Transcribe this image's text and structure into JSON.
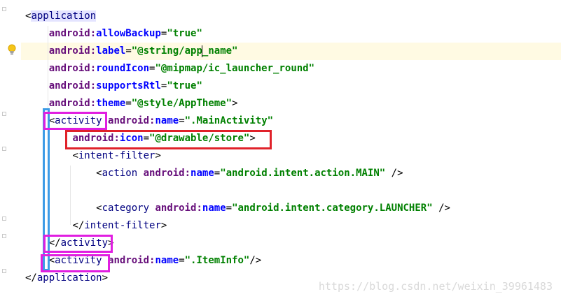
{
  "editor": {
    "lines": [
      [
        {
          "t": "br",
          "v": "<"
        },
        {
          "t": "tag",
          "v": "application",
          "hl": true
        }
      ],
      [
        {
          "t": "plain",
          "v": "    "
        },
        {
          "t": "ns",
          "v": "android:"
        },
        {
          "t": "attr",
          "v": "allowBackup"
        },
        {
          "t": "plain",
          "v": "="
        },
        {
          "t": "val",
          "v": "\"true\""
        }
      ],
      [
        {
          "t": "plain",
          "v": "    "
        },
        {
          "t": "ns",
          "v": "android:"
        },
        {
          "t": "attr",
          "v": "label"
        },
        {
          "t": "plain",
          "v": "="
        },
        {
          "t": "val",
          "v": "\"@string/app"
        },
        {
          "t": "caret"
        },
        {
          "t": "val",
          "v": "_name\""
        }
      ],
      [
        {
          "t": "plain",
          "v": "    "
        },
        {
          "t": "ns",
          "v": "android:"
        },
        {
          "t": "attr",
          "v": "roundIcon"
        },
        {
          "t": "plain",
          "v": "="
        },
        {
          "t": "val",
          "v": "\"@mipmap/ic_launcher_round\""
        }
      ],
      [
        {
          "t": "plain",
          "v": "    "
        },
        {
          "t": "ns",
          "v": "android:"
        },
        {
          "t": "attr",
          "v": "supportsRtl"
        },
        {
          "t": "plain",
          "v": "="
        },
        {
          "t": "val",
          "v": "\"true\""
        }
      ],
      [
        {
          "t": "plain",
          "v": "    "
        },
        {
          "t": "ns",
          "v": "android:"
        },
        {
          "t": "attr",
          "v": "theme"
        },
        {
          "t": "plain",
          "v": "="
        },
        {
          "t": "val",
          "v": "\"@style/AppTheme\""
        },
        {
          "t": "br",
          "v": ">"
        }
      ],
      [
        {
          "t": "plain",
          "v": "    "
        },
        {
          "t": "br",
          "v": "<"
        },
        {
          "t": "tag",
          "v": "activity"
        },
        {
          "t": "plain",
          "v": " "
        },
        {
          "t": "ns",
          "v": "android:"
        },
        {
          "t": "attr",
          "v": "name"
        },
        {
          "t": "plain",
          "v": "="
        },
        {
          "t": "val",
          "v": "\".MainActivity\""
        }
      ],
      [
        {
          "t": "plain",
          "v": "        "
        },
        {
          "t": "ns",
          "v": "android:"
        },
        {
          "t": "attr",
          "v": "icon"
        },
        {
          "t": "plain",
          "v": "="
        },
        {
          "t": "val",
          "v": "\"@drawable/store\""
        },
        {
          "t": "br",
          "v": ">"
        }
      ],
      [
        {
          "t": "plain",
          "v": "        "
        },
        {
          "t": "br",
          "v": "<"
        },
        {
          "t": "tag",
          "v": "intent-filter"
        },
        {
          "t": "br",
          "v": ">"
        }
      ],
      [
        {
          "t": "plain",
          "v": "            "
        },
        {
          "t": "br",
          "v": "<"
        },
        {
          "t": "tag",
          "v": "action"
        },
        {
          "t": "plain",
          "v": " "
        },
        {
          "t": "ns",
          "v": "android:"
        },
        {
          "t": "attr",
          "v": "name"
        },
        {
          "t": "plain",
          "v": "="
        },
        {
          "t": "val",
          "v": "\"android.intent.action.MAIN\""
        },
        {
          "t": "plain",
          "v": " "
        },
        {
          "t": "br",
          "v": "/>"
        }
      ],
      [],
      [
        {
          "t": "plain",
          "v": "            "
        },
        {
          "t": "br",
          "v": "<"
        },
        {
          "t": "tag",
          "v": "category"
        },
        {
          "t": "plain",
          "v": " "
        },
        {
          "t": "ns",
          "v": "android:"
        },
        {
          "t": "attr",
          "v": "name"
        },
        {
          "t": "plain",
          "v": "="
        },
        {
          "t": "val",
          "v": "\"android.intent.category.LAUNCHER\""
        },
        {
          "t": "plain",
          "v": " "
        },
        {
          "t": "br",
          "v": "/>"
        }
      ],
      [
        {
          "t": "plain",
          "v": "        "
        },
        {
          "t": "br",
          "v": "</"
        },
        {
          "t": "tag",
          "v": "intent-filter"
        },
        {
          "t": "br",
          "v": ">"
        }
      ],
      [
        {
          "t": "plain",
          "v": "    "
        },
        {
          "t": "br",
          "v": "</"
        },
        {
          "t": "tag",
          "v": "activity"
        },
        {
          "t": "br",
          "v": ">"
        }
      ],
      [
        {
          "t": "plain",
          "v": "    "
        },
        {
          "t": "br",
          "v": "<"
        },
        {
          "t": "tag",
          "v": "activity"
        },
        {
          "t": "plain",
          "v": " "
        },
        {
          "t": "ns",
          "v": "android:"
        },
        {
          "t": "attr",
          "v": "name"
        },
        {
          "t": "plain",
          "v": "="
        },
        {
          "t": "val",
          "v": "\".ItemInfo\""
        },
        {
          "t": "br",
          "v": "/>"
        }
      ],
      [
        {
          "t": "br",
          "v": "</"
        },
        {
          "t": "tag",
          "v": "application"
        },
        {
          "t": "br",
          "v": ">"
        }
      ]
    ],
    "current_line": 2
  },
  "gutter": {
    "intention_icon": "lightbulb-icon"
  },
  "annotations": {
    "highlight_colors": {
      "magenta": "#e11ee1",
      "red": "#e0222a",
      "blue": "#3d9be6"
    }
  },
  "watermark": "https://blog.csdn.net/weixin_39961483"
}
